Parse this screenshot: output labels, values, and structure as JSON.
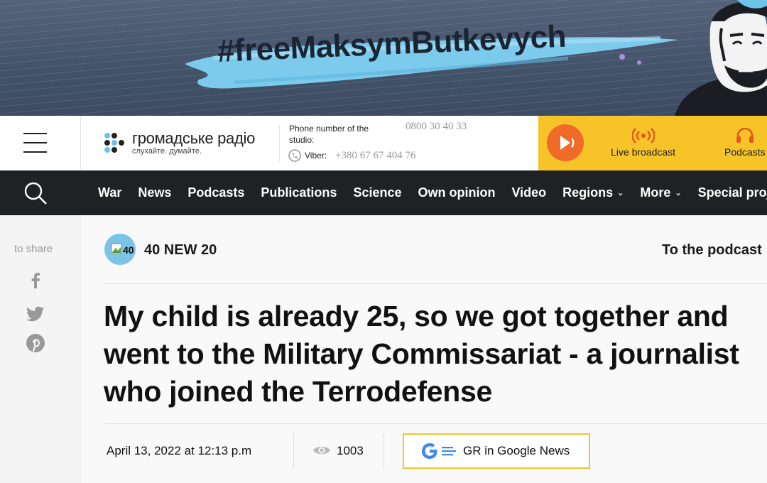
{
  "banner": {
    "hashtag": "#freeMaksymButkevych"
  },
  "header": {
    "logo_name": "громадське радіо",
    "logo_tagline": "слухайте. думайте.",
    "phone_label": "Phone number of the studio:",
    "phone_number": "0800 30 40 33",
    "viber_label": "Viber:",
    "viber_number": "+380 67 67 404 76",
    "live_label": "Live broadcast",
    "podcasts_label": "Podcasts"
  },
  "nav": {
    "items": [
      {
        "label": "War",
        "has_dropdown": false
      },
      {
        "label": "News",
        "has_dropdown": false
      },
      {
        "label": "Podcasts",
        "has_dropdown": false
      },
      {
        "label": "Publications",
        "has_dropdown": false
      },
      {
        "label": "Science",
        "has_dropdown": false
      },
      {
        "label": "Own opinion",
        "has_dropdown": false
      },
      {
        "label": "Video",
        "has_dropdown": false
      },
      {
        "label": "Regions",
        "has_dropdown": true
      },
      {
        "label": "More",
        "has_dropdown": true
      },
      {
        "label": "Special projects",
        "has_dropdown": false
      }
    ]
  },
  "share": {
    "label": "to share",
    "icons": [
      "facebook-icon",
      "twitter-icon",
      "pinterest-icon"
    ]
  },
  "article": {
    "podcast_avatar_alt": "40",
    "podcast_name": "40 NEW 20",
    "to_podcast": "To the podcast",
    "headline": "My child is already 25, so we got together and went to the Military Commissariat - a journalist who joined the Terrodefense",
    "date": "April 13, 2022 at 12:13 p.m",
    "views": "1003",
    "google_news_label": "GR in Google News"
  },
  "colors": {
    "accent_yellow": "#f6c428",
    "play_orange": "#f06a2a",
    "nav_bg": "#1f2125",
    "banner_blue": "#6ec3e8"
  }
}
